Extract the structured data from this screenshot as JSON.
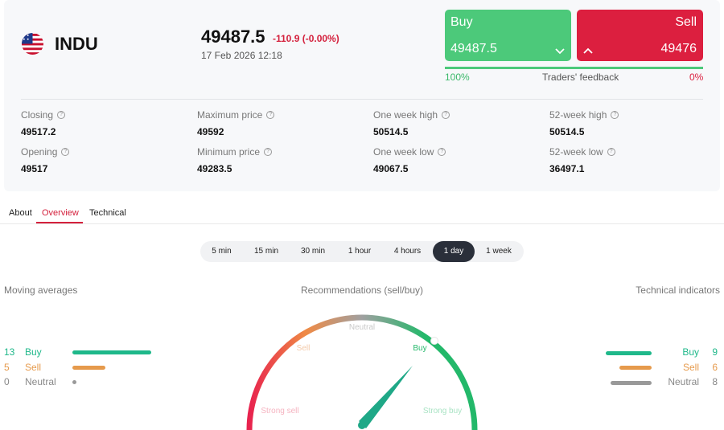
{
  "instrument": {
    "flag_icon": "us-flag-icon",
    "ticker": "INDU",
    "price": "49487.5",
    "change": "-110.9 (-0.00%)",
    "datetime": "17 Feb 2026 12:18"
  },
  "trade": {
    "buy_label": "Buy",
    "buy_price": "49487.5",
    "sell_label": "Sell",
    "sell_price": "49476",
    "buy_color": "#4cc97a",
    "sell_color": "#dc1f3f"
  },
  "feedback": {
    "buy_percent": "100%",
    "label": "Traders' feedback",
    "sell_percent": "0%",
    "buy_fraction": 1.0
  },
  "stats": [
    {
      "label": "Closing",
      "value": "49517.2"
    },
    {
      "label": "Maximum price",
      "value": "49592"
    },
    {
      "label": "One week high",
      "value": "50514.5"
    },
    {
      "label": "52-week high",
      "value": "50514.5"
    },
    {
      "label": "Opening",
      "value": "49517"
    },
    {
      "label": "Minimum price",
      "value": "49283.5"
    },
    {
      "label": "One week low",
      "value": "49067.5"
    },
    {
      "label": "52-week low",
      "value": "36497.1"
    }
  ],
  "tabs": [
    {
      "label": "About"
    },
    {
      "label": "Overview",
      "active": true
    },
    {
      "label": "Technical"
    }
  ],
  "periods": [
    "5 min",
    "15 min",
    "30 min",
    "1 hour",
    "4 hours",
    "1 day",
    "1 week"
  ],
  "active_period": "1 day",
  "moving_averages": {
    "title": "Moving averages",
    "buy": {
      "count": "13",
      "label": "Buy"
    },
    "sell": {
      "count": "5",
      "label": "Sell"
    },
    "neutral": {
      "count": "0",
      "label": "Neutral"
    }
  },
  "recommendations": {
    "title": "Recommendations (sell/buy)",
    "labels": {
      "strong_sell": "Strong sell",
      "sell": "Sell",
      "neutral": "Neutral",
      "buy": "Buy",
      "strong_buy": "Strong buy"
    }
  },
  "technical_indicators": {
    "title": "Technical indicators",
    "buy": {
      "count": "9",
      "label": "Buy"
    },
    "sell": {
      "count": "6",
      "label": "Sell"
    },
    "neutral": {
      "count": "8",
      "label": "Neutral"
    }
  },
  "colors": {
    "buy": "#1fb88a",
    "sell": "#e69a4c",
    "neutral": "#999999",
    "accent": "#d4213d"
  }
}
